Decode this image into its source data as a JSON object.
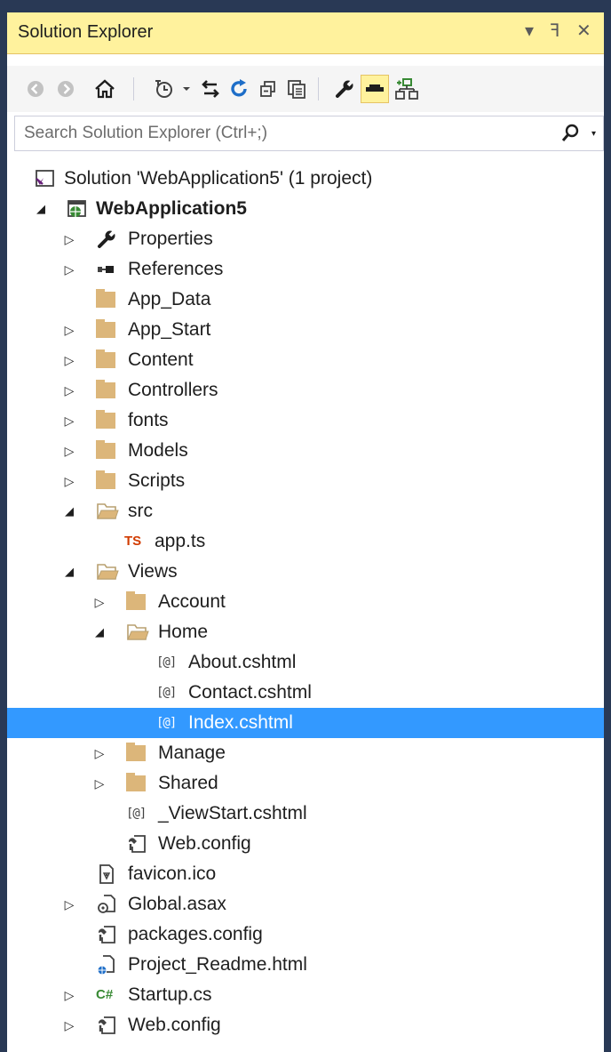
{
  "window": {
    "title": "Solution Explorer",
    "controls": {
      "dropdown": "▾",
      "pin": "ꟻ",
      "close": "✕"
    }
  },
  "toolbar": {
    "buttons": [
      "back",
      "forward",
      "home",
      "pending-changes-filter",
      "sync-with-active-document",
      "refresh",
      "collapse-all",
      "show-all-files",
      "properties",
      "preview-selected-items",
      "view-class-diagram"
    ]
  },
  "search": {
    "placeholder": "Search Solution Explorer (Ctrl+;)"
  },
  "tree": {
    "solution": "Solution 'WebApplication5' (1 project)",
    "project": "WebApplication5",
    "properties": "Properties",
    "references": "References",
    "app_data": "App_Data",
    "app_start": "App_Start",
    "content": "Content",
    "controllers": "Controllers",
    "fonts": "fonts",
    "models": "Models",
    "scripts": "Scripts",
    "src": "src",
    "app_ts": "app.ts",
    "views": "Views",
    "account": "Account",
    "home": "Home",
    "about": "About.cshtml",
    "contact": "Contact.cshtml",
    "index": "Index.cshtml",
    "manage": "Manage",
    "shared": "Shared",
    "viewstart": "_ViewStart.cshtml",
    "views_webconfig": "Web.config",
    "favicon": "favicon.ico",
    "global": "Global.asax",
    "packages": "packages.config",
    "readme": "Project_Readme.html",
    "startup": "Startup.cs",
    "webconfig": "Web.config"
  },
  "icons": {
    "ts_label": "TS",
    "cs_label": "C#",
    "razor_label": "[@]"
  },
  "colors": {
    "selection": "#3399ff",
    "titlebar": "#fff29d",
    "folder": "#dcb67a",
    "frame": "#293955"
  }
}
